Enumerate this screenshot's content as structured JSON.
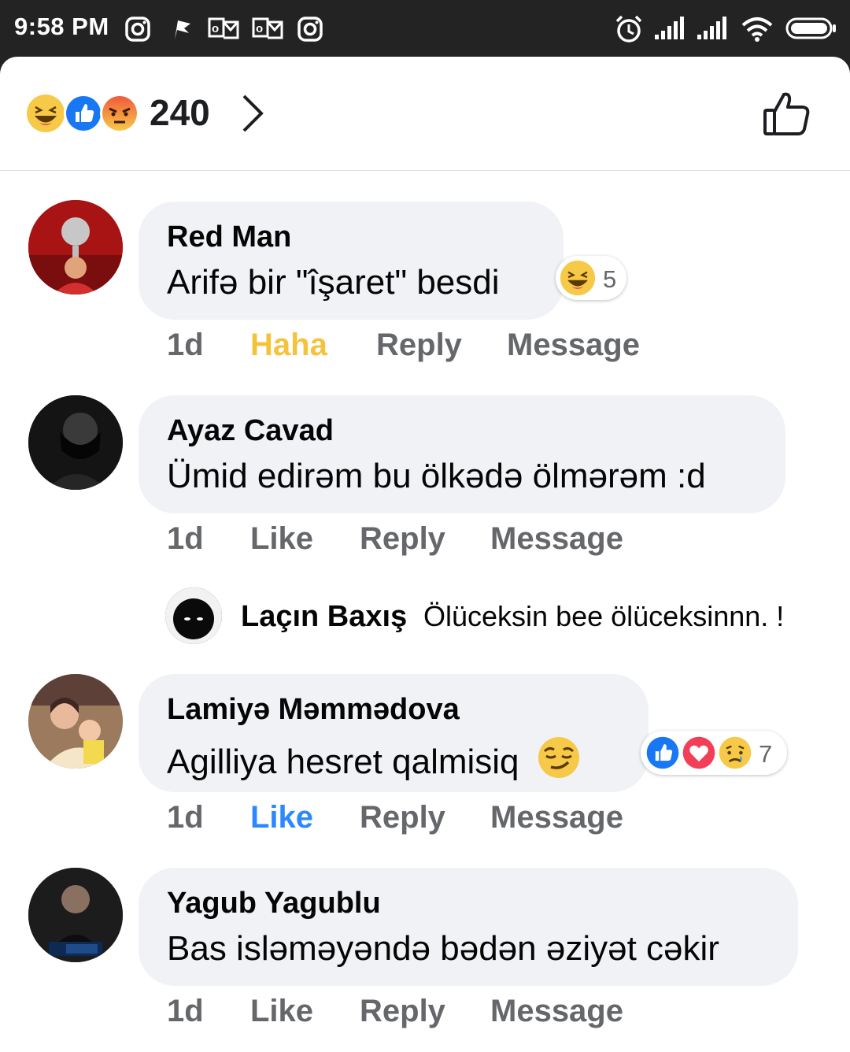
{
  "status_bar": {
    "time": "9:58 PM",
    "icons": [
      "instagram-icon",
      "flag-icon",
      "outlook-icon",
      "outlook-icon",
      "instagram-icon",
      "alarm-icon",
      "signal-icon",
      "signal-icon",
      "wifi-icon",
      "battery-icon"
    ]
  },
  "reactions_header": {
    "emojis": [
      "haha-icon",
      "like-icon",
      "angry-icon"
    ],
    "count": "240",
    "chevron": "chevron-right-icon",
    "like_button": "thumbs-up-outline-icon"
  },
  "comments": [
    {
      "name": "Red Man",
      "text": "Arifə bir \"îşaret\" besdi",
      "time": "1d",
      "like_label": "Haha",
      "reply_label": "Reply",
      "message_label": "Message",
      "reactions": [
        "haha-icon"
      ],
      "reaction_count": "5"
    },
    {
      "name": "Ayaz Cavad",
      "text": "Ümid edirəm bu ölkədə ölmərəm :d",
      "time": "1d",
      "like_label": "Like",
      "reply_label": "Reply",
      "message_label": "Message"
    },
    {
      "name": "Lamiyə Məmmədova",
      "text": "Agilliya hesret qalmisiq",
      "time": "1d",
      "like_label": "Like",
      "reply_label": "Reply",
      "message_label": "Message",
      "reactions": [
        "like-icon",
        "love-icon",
        "sad-icon"
      ],
      "reaction_count": "7"
    },
    {
      "name": "Yagub Yagublu",
      "text": "Bas isləməyəndə bədən əziyət cəkir",
      "time": "1d",
      "like_label": "Like",
      "reply_label": "Reply",
      "message_label": "Message"
    }
  ],
  "reply_preview": {
    "name": "Laçın Baxış",
    "text": "Ölüceksin bee ölüceksinnn. !"
  },
  "colors": {
    "haha_active": "#f5c33b",
    "like_active": "#2d88ff",
    "action_gray": "#65676b",
    "bubble_bg": "#f0f2f5",
    "status_bar_bg": "#232323"
  }
}
